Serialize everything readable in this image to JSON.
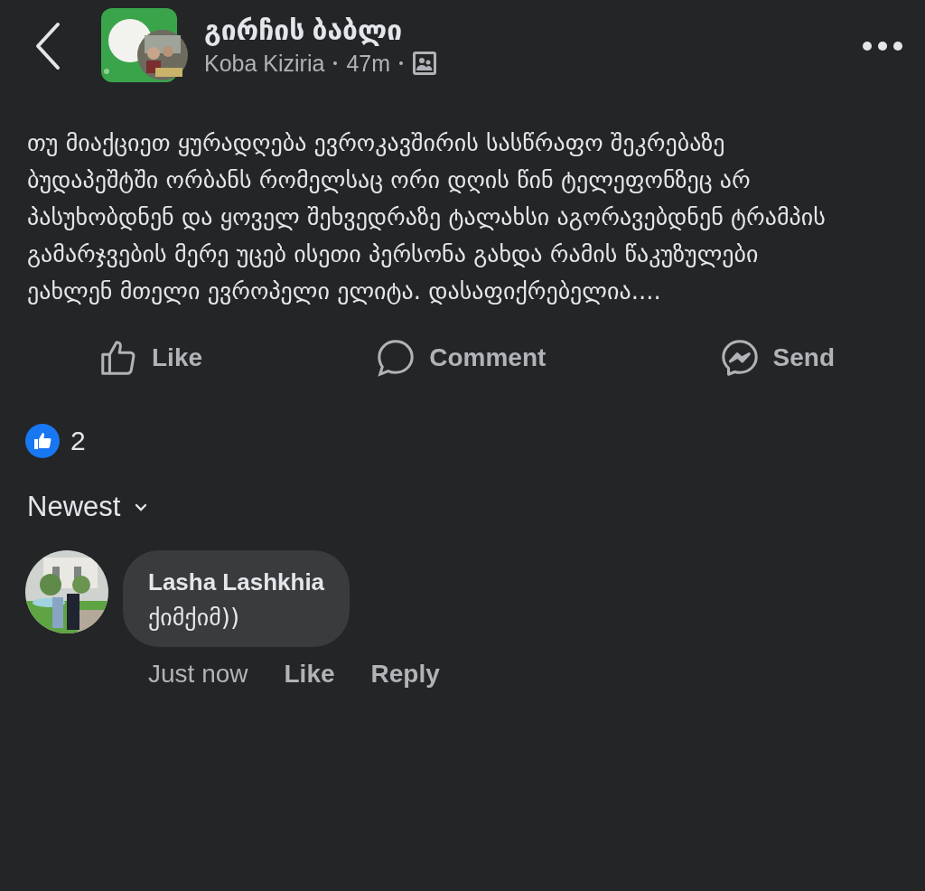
{
  "header": {
    "title": "გირჩის ბაბლი",
    "author": "Koba Kiziria",
    "time": "47m"
  },
  "post": {
    "text": "თუ მიაქციეთ ყურადღება ევროკავშირის სასწრაფო შეკრებაზე ბუდაპეშტში ორბანს რომელსაც ორი დღის წინ ტელეფონზეც არ პასუხობდნენ და ყოველ შეხვედრაზე ტალახსი აგორავებდნენ ტრამპის გამარჯვების მერე უცებ ისეთი პერსონა გახდა რამის წაკუზულები ეახლენ მთელი ევროპელი ელიტა. დასაფიქრებელია...."
  },
  "actions": [
    {
      "kind": "like",
      "label": "Like"
    },
    {
      "kind": "comment",
      "label": "Comment"
    },
    {
      "kind": "send",
      "label": "Send"
    }
  ],
  "reactions": {
    "count": "2"
  },
  "sort": {
    "label": "Newest"
  },
  "comments": [
    {
      "author": "Lasha Lashkhia",
      "text": "ქიმქიმ))",
      "time": "Just now",
      "actions": [
        "Like",
        "Reply"
      ]
    }
  ]
}
